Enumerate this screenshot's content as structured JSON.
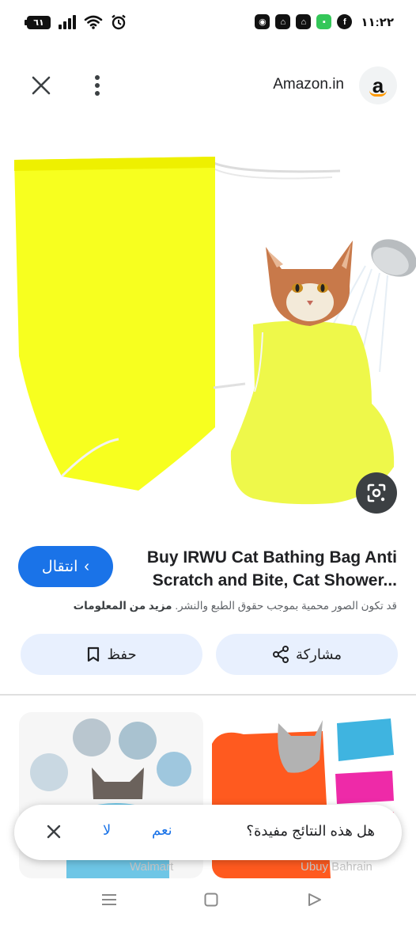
{
  "status_bar": {
    "battery": "٦١",
    "time": "١١:٢٢"
  },
  "header": {
    "site_name": "Amazon.in",
    "logo_letter": "a"
  },
  "product": {
    "title_line1": "Buy IRWU Cat Bathing Bag Anti",
    "title_line2": "Scratch and Bite, Cat Shower...",
    "copyright_text": "قد تكون الصور محمية بموجب حقوق الطبع والنشر.",
    "more_info": "مزيد من المعلومات",
    "visit_label": "انتقال"
  },
  "actions": {
    "save_label": "حفظ",
    "share_label": "مشاركة"
  },
  "related": [
    {
      "source": "Walmart"
    },
    {
      "source": "Ubuy Bahrain"
    }
  ],
  "feedback": {
    "question": "هل هذه النتائج مفيدة؟",
    "yes": "نعم",
    "no": "لا"
  },
  "colors": {
    "accent": "#1a73e8",
    "action_bg": "#e8f0fe",
    "bag_yellow": "#f7ff1f"
  }
}
